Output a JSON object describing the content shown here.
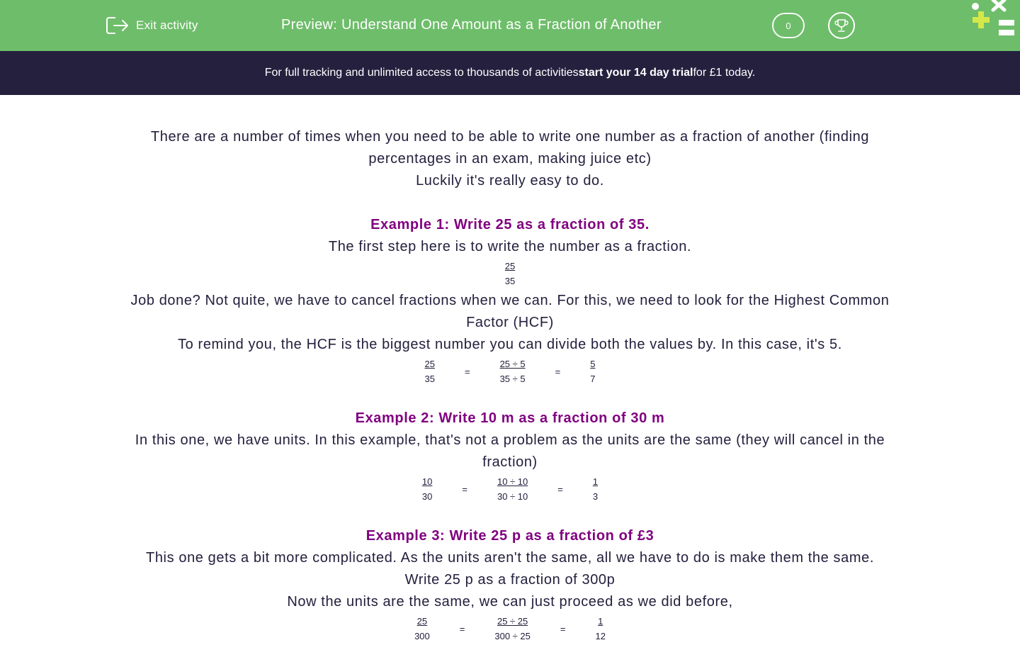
{
  "header": {
    "exit_label": "Exit activity",
    "title": "Preview: Understand One Amount as a Fraction of Another",
    "score": "0"
  },
  "banner": {
    "pre": "For full tracking and unlimited access to thousands of activities ",
    "bold": "start your 14 day trial",
    "post": " for £1 today."
  },
  "intro": {
    "line1": "There are a number of times when you need to be able to write one number as a fraction of another (finding percentages in an exam, making juice etc)",
    "line2": "Luckily it's really easy to do."
  },
  "example1": {
    "heading": "Example 1: Write 25 as a fraction of 35.",
    "text1": "The first step here is to write the number as a fraction.",
    "frac": {
      "num": "25",
      "den": "35"
    },
    "text2": "Job done? Not quite, we have to cancel fractions when we can. For this, we need to look for the Highest Common Factor (HCF)",
    "text3": "To remind you, the HCF is the biggest number you can divide both the values by. In this case, it's 5.",
    "eq": {
      "a_num": "25",
      "a_den": "35",
      "b_num": "25 ÷ 5",
      "b_den": "35 ÷ 5",
      "c_num": "5",
      "c_den": "7",
      "sign": "="
    }
  },
  "example2": {
    "heading": "Example 2: Write 10 m as a fraction of 30 m",
    "text1": "In this one, we have units. In this example, that's not a problem as the units are the same (they will cancel in the fraction)",
    "eq": {
      "a_num": "10",
      "a_den": "30",
      "b_num": "10 ÷ 10",
      "b_den": "30 ÷ 10",
      "c_num": "1",
      "c_den": "3",
      "sign": "="
    }
  },
  "example3": {
    "heading": "Example 3: Write 25 p as a fraction of £3",
    "text1": "This one gets a bit more complicated. As the units aren't the same, all we have to do is make them the same.",
    "text2": "Write 25 p as a fraction of 300p",
    "text3": "Now the units are the same, we can just proceed as we did before,",
    "eq": {
      "a_num": "25",
      "a_den": "300",
      "b_num": "25 ÷ 25",
      "b_den": "300 ÷ 25",
      "c_num": "1",
      "c_den": "12",
      "sign": "="
    }
  },
  "colors": {
    "header_bg": "#6ebd6a",
    "banner_bg": "#24203e",
    "heading": "#800080",
    "text": "#23203d"
  },
  "icons": {
    "exit": "exit-icon",
    "trophy": "trophy-icon",
    "logo": "edplace-logo-icon"
  }
}
